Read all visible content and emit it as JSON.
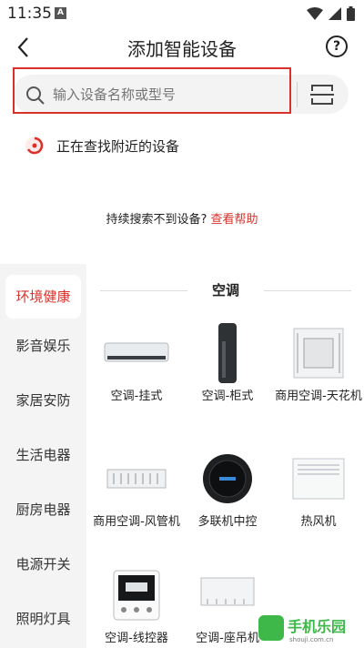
{
  "status": {
    "time": "11:35",
    "badge": "A"
  },
  "header": {
    "title": "添加智能设备"
  },
  "search": {
    "placeholder": "输入设备名称或型号"
  },
  "nearby": {
    "text": "正在查找附近的设备"
  },
  "hint": {
    "text": "持续搜索不到设备?",
    "link": "查看帮助"
  },
  "sidebar": {
    "items": [
      {
        "label": "环境健康",
        "active": true
      },
      {
        "label": "影音娱乐"
      },
      {
        "label": "家居安防"
      },
      {
        "label": "生活电器"
      },
      {
        "label": "厨房电器"
      },
      {
        "label": "电源开关"
      },
      {
        "label": "照明灯具"
      }
    ]
  },
  "section": {
    "title": "空调"
  },
  "devices": [
    {
      "label": "空调-挂式",
      "icon": "wall-ac"
    },
    {
      "label": "空调-柜式",
      "icon": "floor-ac"
    },
    {
      "label": "商用空调-天花机",
      "icon": "ceiling-cassette"
    },
    {
      "label": "商用空调-风管机",
      "icon": "duct-ac"
    },
    {
      "label": "多联机中控",
      "icon": "central-controller"
    },
    {
      "label": "热风机",
      "icon": "heater"
    },
    {
      "label": "空调-线控器",
      "icon": "wired-controller"
    },
    {
      "label": "空调-座吊机",
      "icon": "floor-ceiling-ac"
    }
  ],
  "watermark": {
    "text": "手机乐园",
    "sub": "shouji.com.cn"
  },
  "colors": {
    "accent": "#d9302a"
  }
}
